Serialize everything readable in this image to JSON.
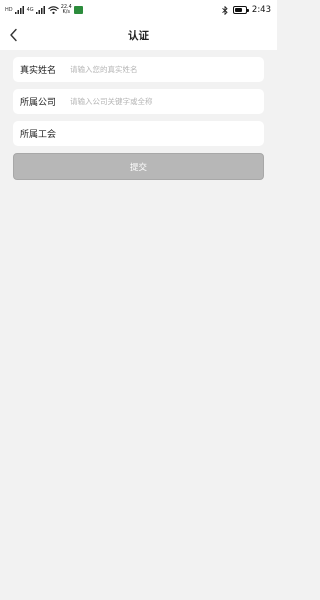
{
  "status_bar": {
    "carrier_left": "HD",
    "carrier_right": "HD",
    "signal_1": "4G",
    "signal_2": "4G",
    "speed_value": "22.4",
    "speed_unit": "K/s",
    "time": "2:43",
    "icons": [
      "signal-icon",
      "signal-icon",
      "wifi-icon",
      "app-notification-icon",
      "bluetooth-icon",
      "battery-icon"
    ]
  },
  "nav": {
    "title": "认证",
    "back_icon": "chevron-left-icon"
  },
  "form": {
    "fields": [
      {
        "label": "真实姓名",
        "placeholder": "请输入您的真实姓名",
        "value": ""
      },
      {
        "label": "所属公司",
        "placeholder": "请输入公司关键字或全称",
        "value": ""
      },
      {
        "label": "所属工会",
        "placeholder": "",
        "value": ""
      }
    ],
    "submit_label": "提交",
    "submit_disabled": true
  },
  "colors": {
    "page_bg": "#f2f2f2",
    "card_bg": "#ffffff",
    "button_disabled": "#b7b7b7",
    "placeholder": "#b5b5b5",
    "text": "#222222"
  }
}
